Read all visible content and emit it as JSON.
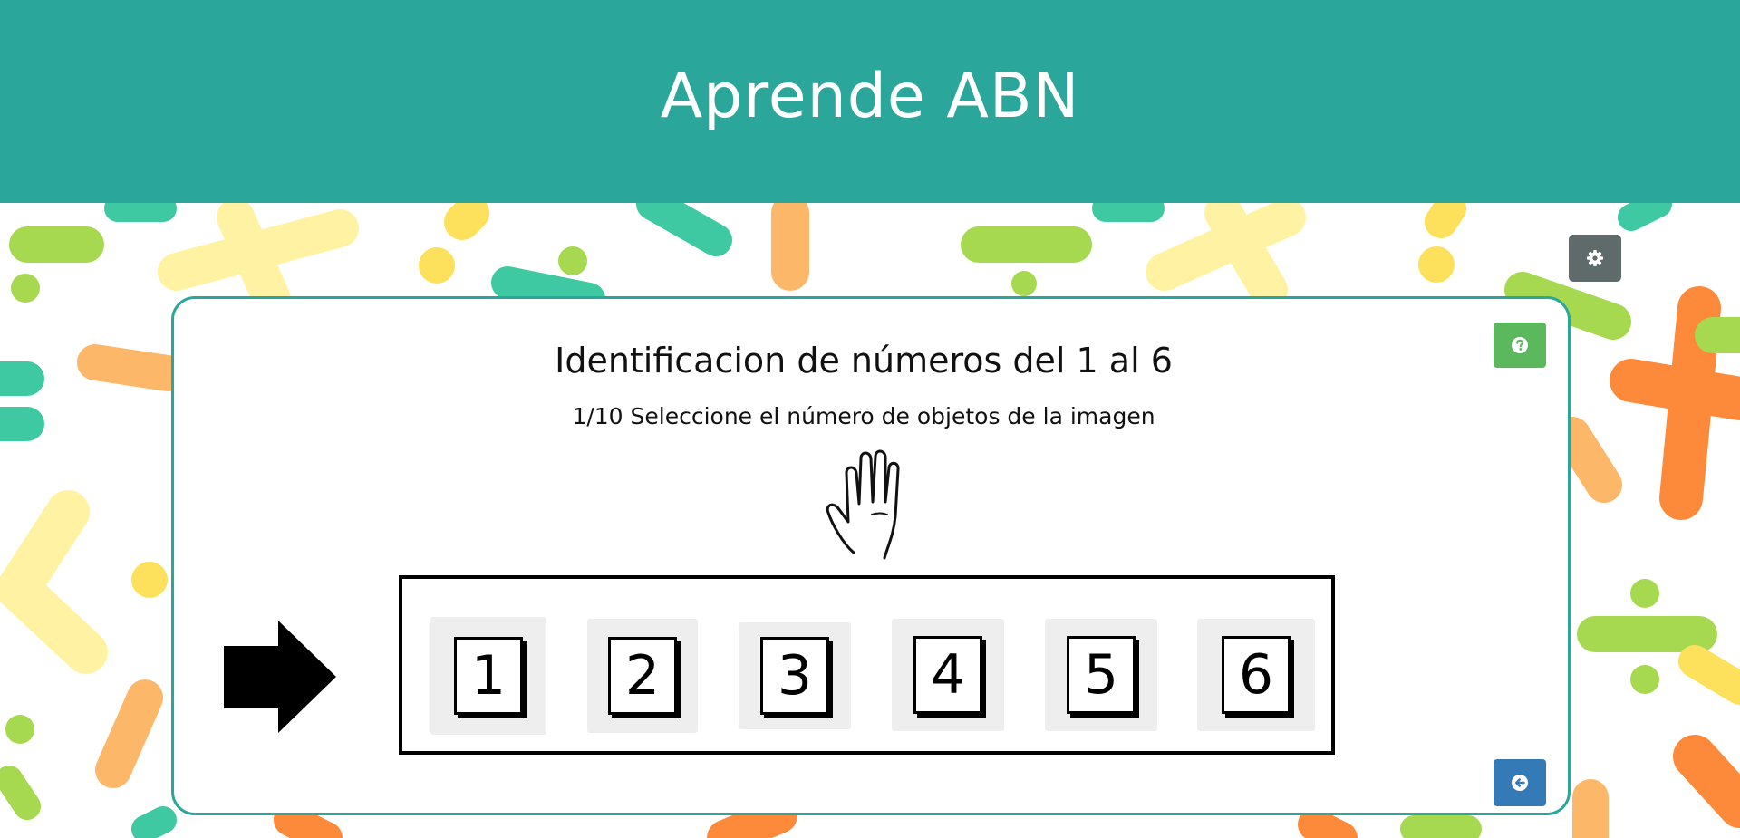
{
  "header": {
    "title": "Aprende ABN"
  },
  "activity": {
    "title": "Identificacion de números del 1 al 6",
    "instruction": "1/10 Seleccione el número de objetos de la imagen"
  },
  "image": {
    "icon": "hand-icon"
  },
  "options": [
    {
      "label": "1"
    },
    {
      "label": "2"
    },
    {
      "label": "3"
    },
    {
      "label": "4"
    },
    {
      "label": "5"
    },
    {
      "label": "6"
    }
  ],
  "buttons": {
    "settings_icon": "gear-icon",
    "help_icon": "question-icon",
    "back_icon": "arrow-left-icon"
  },
  "colors": {
    "header": "#2aa69a",
    "settings": "#5f6b6b",
    "help": "#5cb85c",
    "back": "#337ab7"
  }
}
